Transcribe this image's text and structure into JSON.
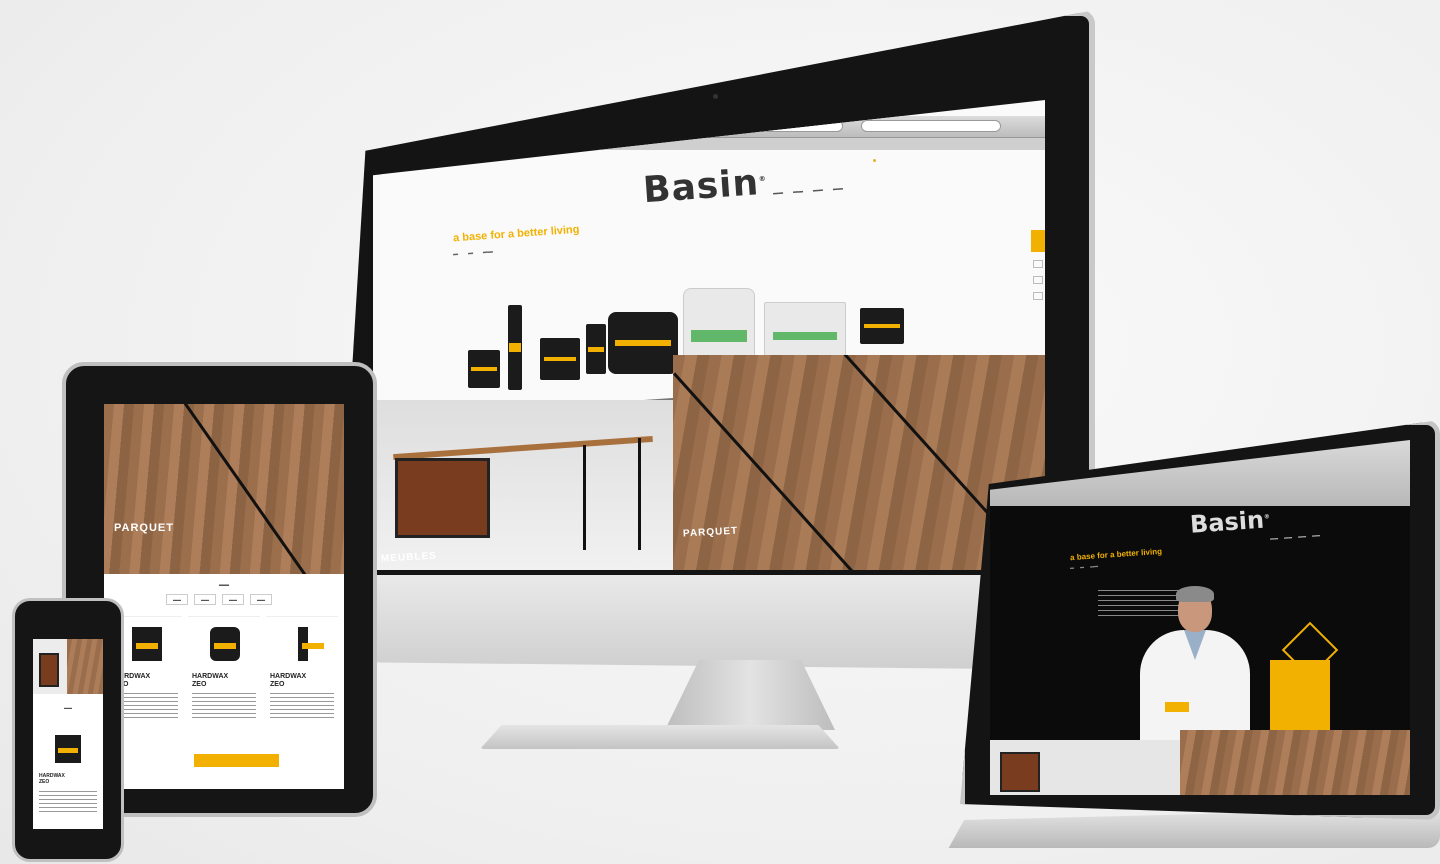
{
  "brand": {
    "logo": "Basin",
    "logo_mark": "®",
    "tagline": "a base for a better living",
    "accent_color": "#f2b100",
    "wood_color": "#9a6e4c"
  },
  "desktop": {
    "hero_labels": {
      "left": "MEUBLES",
      "right": "PARQUET"
    }
  },
  "tablet": {
    "hero_label": "PARQUET",
    "products": [
      {
        "name": "HARDWAX\nZEO"
      },
      {
        "name": "HARDWAX\nZEO"
      },
      {
        "name": "HARDWAX\nZEO"
      }
    ]
  },
  "phone": {
    "product_name": "HARDWAX\nZEO"
  },
  "icons": [
    "apple-icon",
    "search-icon",
    "cart-icon",
    "chevron-left-icon",
    "chevron-right-icon"
  ]
}
